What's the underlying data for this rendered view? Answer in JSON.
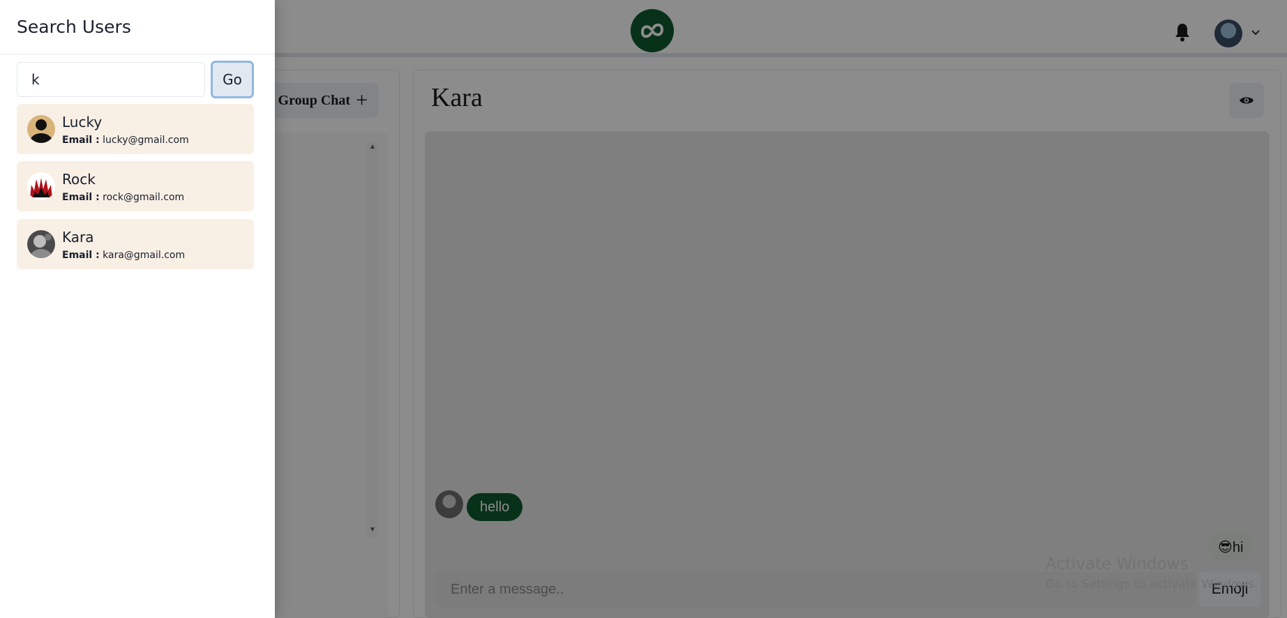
{
  "drawer": {
    "title": "Search Users",
    "search_value": "k",
    "go_label": "Go",
    "email_label": "Email :",
    "results": [
      {
        "name": "Lucky",
        "email": "lucky@gmail.com",
        "avatar": "silhouette-avatar"
      },
      {
        "name": "Rock",
        "email": "rock@gmail.com",
        "avatar": "red-flames-avatar"
      },
      {
        "name": "Kara",
        "email": "kara@gmail.com",
        "avatar": "grayscale-photo-avatar"
      }
    ]
  },
  "sidebar": {
    "new_group_label": "Group Chat",
    "new_group_icon": "plus-icon"
  },
  "chat": {
    "title": "Kara",
    "messages": [
      {
        "text": "hello",
        "side": "left"
      },
      {
        "text": "😎hi",
        "side": "right"
      }
    ],
    "input_placeholder": "Enter a message..",
    "emoji_label": "Emoji"
  },
  "watermark": {
    "title": "Activate Windows",
    "subtitle": "Go to Settings to activate Windows."
  },
  "colors": {
    "brand_green": "#0f5a2e",
    "result_bg": "#f8efe5",
    "go_focus_ring": "#90b6e3"
  }
}
